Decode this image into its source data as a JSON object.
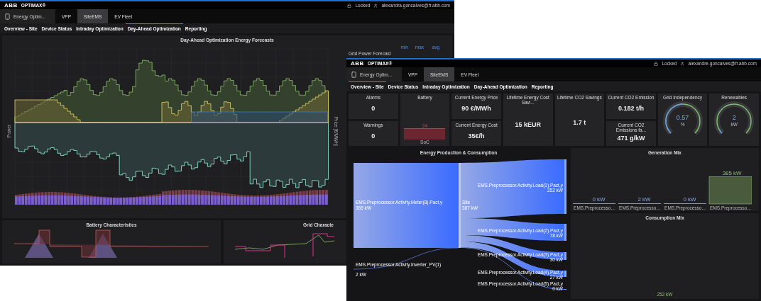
{
  "back_window": {
    "logo": "ABB",
    "product": "OPTIMAX®",
    "locked": "Locked",
    "user": "alexandra.goncalves@fr.abb.com",
    "app_tile": "Energy Optim...",
    "tabs": [
      {
        "label": "VPP",
        "selected": false
      },
      {
        "label": "SiteEMS",
        "selected": true
      },
      {
        "label": "EV Fleet",
        "selected": false
      }
    ],
    "subtabs": [
      {
        "label": "Overview - Site",
        "selected": false
      },
      {
        "label": "Device Status",
        "selected": false
      },
      {
        "label": "Intraday Optimization",
        "selected": false
      },
      {
        "label": "Day-Ahead Optimization",
        "selected": true
      },
      {
        "label": "Reporting",
        "selected": false
      }
    ],
    "forecast_panel": {
      "title": "Day-Ahead Optimization Energy Forecasts",
      "y_label": "Power",
      "y2_label": "Price [€/MWh]",
      "legend_headers": [
        "min",
        "max",
        "avg"
      ],
      "legend_series": [
        "Grid Power Forecast"
      ]
    },
    "lower_panels": [
      {
        "title": "Battery Characteristics",
        "kind": "battery"
      },
      {
        "title": "Grid Characte",
        "kind": "grid"
      }
    ]
  },
  "front_window": {
    "logo": "ABB",
    "product": "OPTIMAX®",
    "locked": "Locked",
    "user": "alexandre.goncalves@fr.abb.com",
    "app_tile": "Energy Optim...",
    "tabs": [
      {
        "label": "VPP",
        "selected": false
      },
      {
        "label": "SiteEMS",
        "selected": true
      },
      {
        "label": "EV Fleet",
        "selected": false
      }
    ],
    "subtabs": [
      {
        "label": "Overview - Site",
        "selected": true
      },
      {
        "label": "Device Status",
        "selected": false
      },
      {
        "label": "Intraday Optimization",
        "selected": false
      },
      {
        "label": "Day-Ahead Optimization",
        "selected": false
      },
      {
        "label": "Reporting",
        "selected": false
      }
    ],
    "kpi_columns": [
      {
        "kind": "stack",
        "items": [
          {
            "title": "Alarms",
            "value": "0"
          },
          {
            "title": "Warnings",
            "value": "0"
          }
        ]
      },
      {
        "kind": "battery",
        "title": "Battery",
        "reading": "24",
        "label": "SoC"
      },
      {
        "kind": "stack",
        "items": [
          {
            "title": "Current Energy Price",
            "value": "90 €/MWh"
          },
          {
            "title": "Current Energy Cost",
            "value": "35€/h"
          }
        ]
      },
      {
        "kind": "single",
        "title": "Lifetime Energy Cost Savi...",
        "value": "15 kEUR"
      },
      {
        "kind": "single",
        "title": "Lifetime CO2 Savings",
        "value": "1.7 t"
      },
      {
        "kind": "stack",
        "items": [
          {
            "title": "Current CO2 Emission",
            "value": "0.182 t/h"
          },
          {
            "title": "Current CO2 Emissions fa...",
            "value": "471 g/kW"
          }
        ]
      },
      {
        "kind": "gauge",
        "title": "Grid Independency",
        "value": "0.57",
        "unit": "%",
        "level": 0.5
      },
      {
        "kind": "gauge",
        "title": "Renewables",
        "value": "2",
        "unit": "kW",
        "level": 0.06
      }
    ],
    "sankey": {
      "title": "Energy Production & Consumption",
      "sources": [
        {
          "label": "EMS.Preprocessor.Activity.Meter(8).Pact,y",
          "value": "385 kW"
        },
        {
          "label": "EMS.Preprocessor.Activity.Inverter_PV(1)",
          "value": "2 kW"
        }
      ],
      "hub": {
        "label": "Site",
        "value": "387 kW"
      },
      "targets": [
        {
          "label": "EMS.Preprocessor.Activity.Load(1).Pact,y",
          "value": "252 kW"
        },
        {
          "label": "EMS.Preprocessor.Activity.Load(2).Pact,y",
          "value": "78 kW"
        },
        {
          "label": "EMS.Preprocessor.Activity.Load(3).Pact,y",
          "value": "30 kW"
        },
        {
          "label": "EMS.Preprocessor.Activity.Load(4).Pact,y",
          "value": "27 kW"
        },
        {
          "label": "EMS.Preprocessor.Activity.Load(5).Pact,y",
          "value": "0 kW"
        }
      ]
    },
    "generation_mix": {
      "title": "Generation Mix",
      "chart_data": {
        "type": "bar",
        "categories": [
          "EMS.Preprocesso...",
          "EMS.Preprocesso...",
          "EMS.Preprocesso...",
          "EMS.Preprocesso..."
        ],
        "series": [
          {
            "color": "#4a5a3c",
            "values": [
              0,
              2,
              0,
              385
            ]
          }
        ],
        "data_labels": true,
        "ylabel": "kW"
      }
    },
    "consumption_mix": {
      "title": "Consumption Mix",
      "value": "252 kW"
    }
  }
}
